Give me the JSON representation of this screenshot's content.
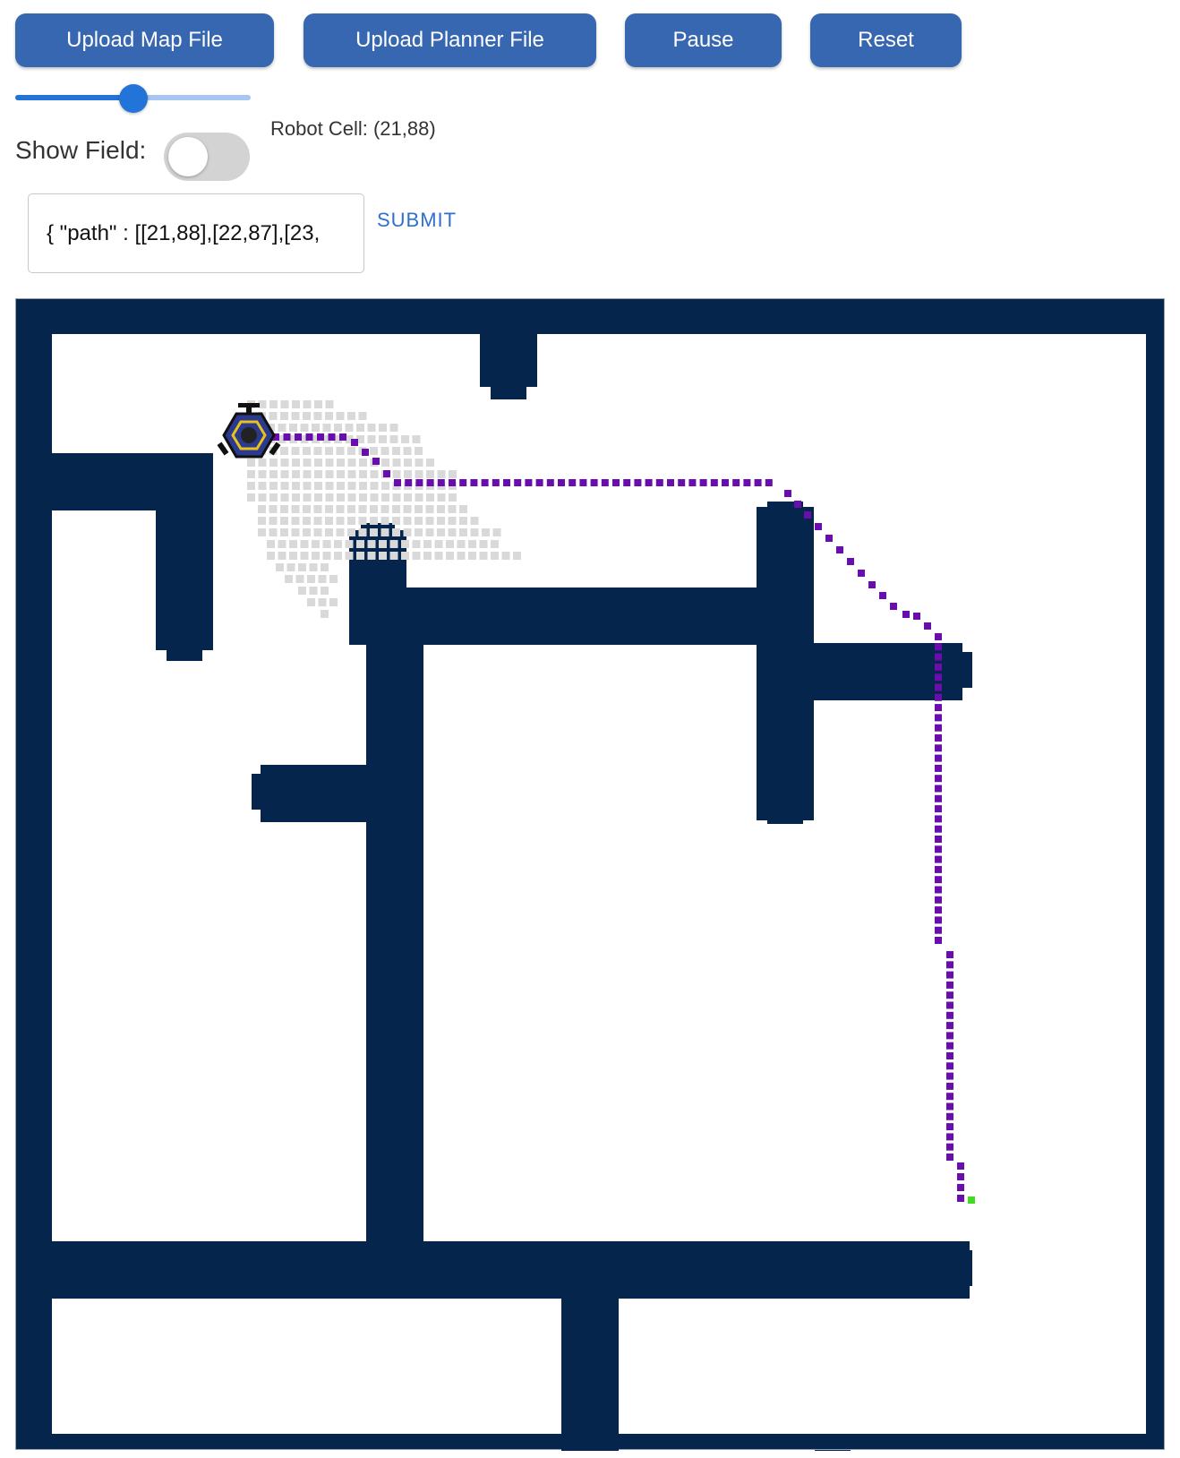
{
  "toolbar": {
    "upload_map_label": "Upload Map File",
    "upload_planner_label": "Upload Planner File",
    "pause_label": "Pause",
    "reset_label": "Reset"
  },
  "speed_slider": {
    "value_fraction": 0.5
  },
  "show_field": {
    "label": "Show Field:",
    "on": false
  },
  "robot": {
    "cell_label": "Robot Cell:",
    "cell_value": "(21,88)"
  },
  "path_input": {
    "value": "{ \"path\" : [[21,88],[22,87],[23,",
    "submit_label": "SUBMIT"
  },
  "map": {
    "wall_color": "#05254d",
    "floor_color": "#ffffff",
    "path_color": "#6a0dad",
    "goal_color": "#3fdc20",
    "field_color": "#d9d9d9"
  }
}
